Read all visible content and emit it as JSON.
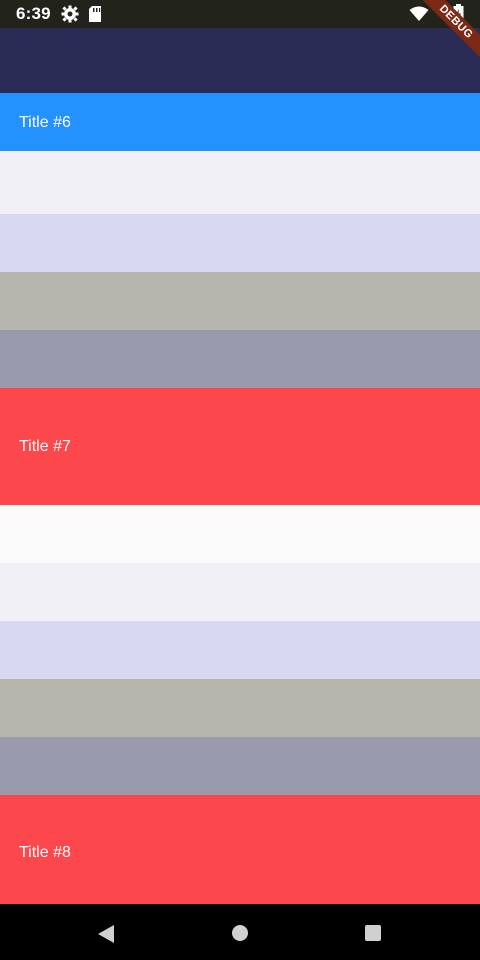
{
  "status_bar": {
    "time": "6:39",
    "icons": [
      "gear-icon",
      "sd-card-icon",
      "wifi-icon",
      "battery-icon"
    ],
    "debug_banner": "DEBUG"
  },
  "list": {
    "items": [
      {
        "type": "band",
        "color": "#2a2c55"
      },
      {
        "type": "tile",
        "title": "Title #6",
        "color": "#2391fe"
      },
      {
        "type": "band",
        "color": "#f1f0f7"
      },
      {
        "type": "band",
        "color": "#d8d8f0"
      },
      {
        "type": "band",
        "color": "#b5b5ad"
      },
      {
        "type": "band",
        "color": "#9a9aae"
      },
      {
        "type": "tile",
        "title": "Title #7",
        "color": "#fc474c"
      },
      {
        "type": "band",
        "color": "#fafafb"
      },
      {
        "type": "band",
        "color": "#f1f0f7"
      },
      {
        "type": "band",
        "color": "#d8d8f0"
      },
      {
        "type": "band",
        "color": "#b5b5ad"
      },
      {
        "type": "band",
        "color": "#9a9aae"
      },
      {
        "type": "tile",
        "title": "Title #8",
        "color": "#fc474c"
      }
    ]
  },
  "nav_bar": {
    "buttons": [
      "back-icon",
      "home-icon",
      "recents-icon"
    ],
    "color": "#000000"
  }
}
